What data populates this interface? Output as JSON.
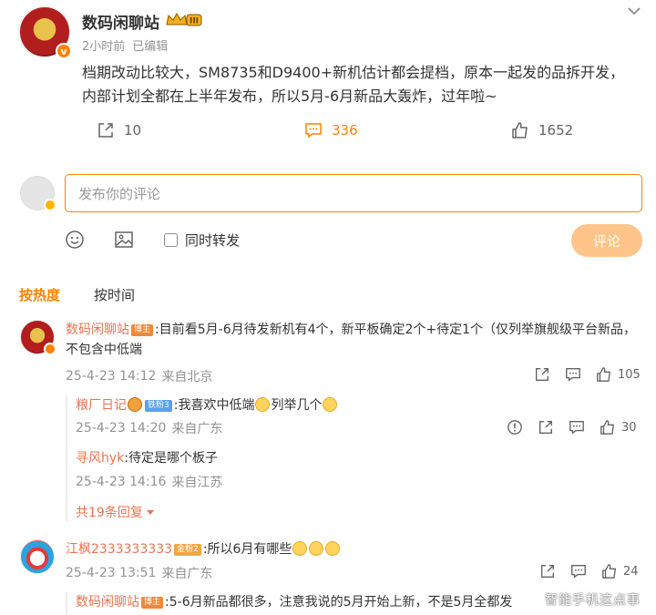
{
  "post": {
    "author": "数码闲聊站",
    "time": "2小时前",
    "edited": "已编辑",
    "text": "档期改动比较大，SM8735和D9400+新机估计都会提档，原本一起发的品拆开发，内部计划全都在上半年发布，所以5月-6月新品大轰炸，过年啦~",
    "level_badge": "III",
    "shares": "10",
    "comments": "336",
    "likes": "1652"
  },
  "compose": {
    "placeholder": "发布你的评论",
    "repost_label": "同时转发",
    "submit_label": "评论"
  },
  "sort": {
    "hot": "按热度",
    "time": "按时间"
  },
  "comments": [
    {
      "author": "数码闲聊站",
      "tag": "博主",
      "text": ":目前看5月-6月待发新机有4个，新平板确定2个+待定1个（仅列举旗舰级平台新品，不包含中低端",
      "date": "25-4-23 14:12",
      "location": "来自北京",
      "likes": "105",
      "replies": [
        {
          "author": "粮厂日记",
          "tag": "铁粉3",
          "text": ":我喜欢中低端",
          "text2": "列举几个",
          "date": "25-4-23 14:20",
          "location": "来自广东",
          "likes": "30"
        },
        {
          "author": "寻风hyk",
          "text": ":待定是哪个板子",
          "date": "25-4-23 14:16",
          "location": "来自江苏"
        }
      ],
      "more": "共19条回复"
    },
    {
      "author": "江枫2333333333",
      "tag": "金粉2",
      "text": ":所以6月有哪些",
      "date": "25-4-23 13:51",
      "location": "来自广东",
      "likes": "24",
      "replies": [
        {
          "author": "数码闲聊站",
          "tag": "博主",
          "text": ":5-6月新品都很多，注意我说的5月开始上新，不是5月全都发"
        }
      ]
    }
  ],
  "watermark": "智能手机这点事",
  "colors": {
    "accent": "#ff8200",
    "username": "#eb7350",
    "meta": "#939393"
  }
}
